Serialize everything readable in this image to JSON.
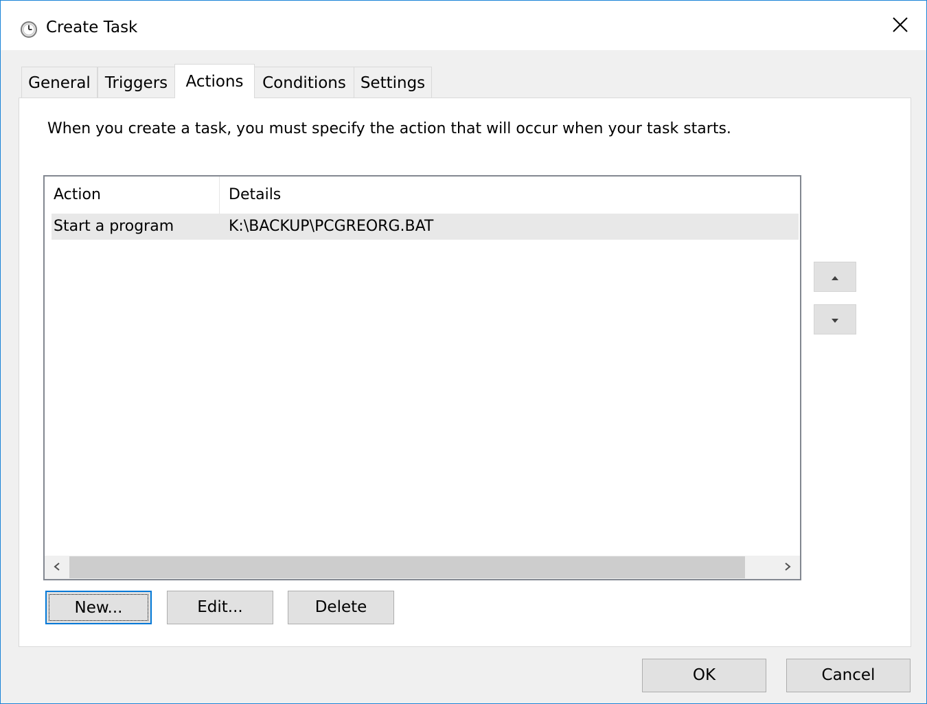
{
  "window": {
    "title": "Create Task",
    "close_label": "×"
  },
  "tabs": [
    {
      "label": "General",
      "active": false
    },
    {
      "label": "Triggers",
      "active": false
    },
    {
      "label": "Actions",
      "active": true
    },
    {
      "label": "Conditions",
      "active": false
    },
    {
      "label": "Settings",
      "active": false
    }
  ],
  "actions_panel": {
    "description": "When you create a task, you must specify the action that will occur when your task starts.",
    "columns": [
      "Action",
      "Details"
    ],
    "rows": [
      {
        "action": "Start a program",
        "details": "K:\\BACKUP\\PCGREORG.BAT"
      }
    ],
    "scroll_left": "‹",
    "scroll_right": "›",
    "buttons": {
      "new": "New...",
      "edit": "Edit...",
      "delete": "Delete"
    }
  },
  "footer": {
    "ok": "OK",
    "cancel": "Cancel"
  },
  "icons": {
    "title": "clock-icon",
    "close": "close-icon",
    "move_up": "arrow-up-icon",
    "move_down": "arrow-down-icon"
  },
  "colors": {
    "accent": "#0078d7",
    "window_border": "#1883d7",
    "selected_row": "#e8e8e8"
  }
}
